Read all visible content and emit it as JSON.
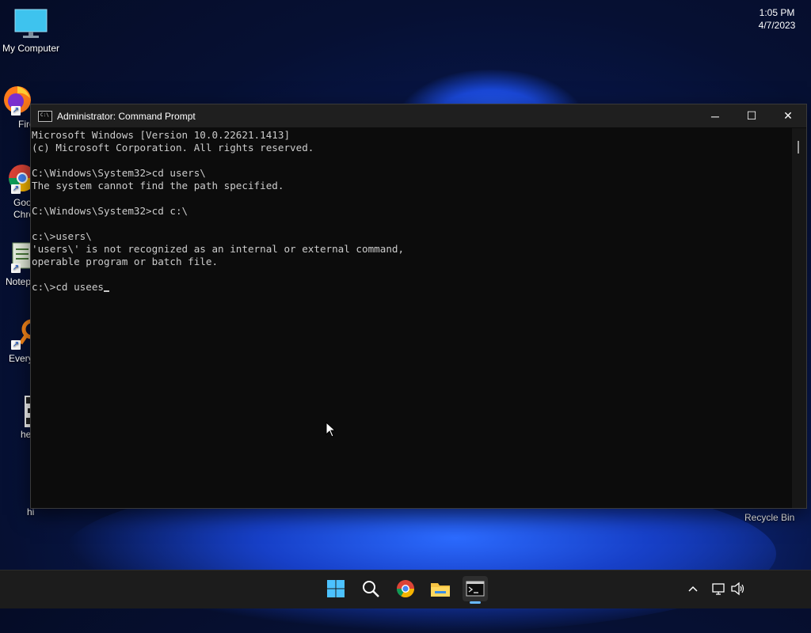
{
  "desktop": {
    "icons": [
      {
        "label": "My Computer"
      },
      {
        "label": "Fire"
      },
      {
        "label": "Goo Chro"
      },
      {
        "label": "Notep"
      },
      {
        "label": "Every"
      },
      {
        "label": "he"
      },
      {
        "label": "hi"
      }
    ],
    "recycle_bin": "Recycle Bin"
  },
  "window": {
    "title": "Administrator: Command Prompt",
    "app_icon_text": "C:\\",
    "controls": {
      "minimize": "─",
      "maximize": "☐",
      "close": "✕"
    },
    "console_lines": [
      "Microsoft Windows [Version 10.0.22621.1413]",
      "(c) Microsoft Corporation. All rights reserved.",
      "",
      "C:\\Windows\\System32>cd users\\",
      "The system cannot find the path specified.",
      "",
      "C:\\Windows\\System32>cd c:\\",
      "",
      "c:\\>users\\",
      "'users\\' is not recognized as an internal or external command,",
      "operable program or batch file.",
      "",
      "c:\\>cd usees"
    ]
  },
  "taskbar": {
    "apps": [
      {
        "name": "start",
        "icon": "windows-logo-icon"
      },
      {
        "name": "search",
        "icon": "search-icon"
      },
      {
        "name": "chrome",
        "icon": "chrome-icon"
      },
      {
        "name": "file-explorer",
        "icon": "folder-icon"
      },
      {
        "name": "command-prompt",
        "icon": "terminal-icon",
        "active": true
      }
    ],
    "tray": {
      "chevron": "︿"
    },
    "clock": {
      "time": "1:05 PM",
      "date": "4/7/2023"
    }
  },
  "colors": {
    "accent": "#68b8ff",
    "console_bg": "#0c0c0c",
    "console_text": "#cccccc",
    "taskbar_bg": "#1c1c1c"
  }
}
